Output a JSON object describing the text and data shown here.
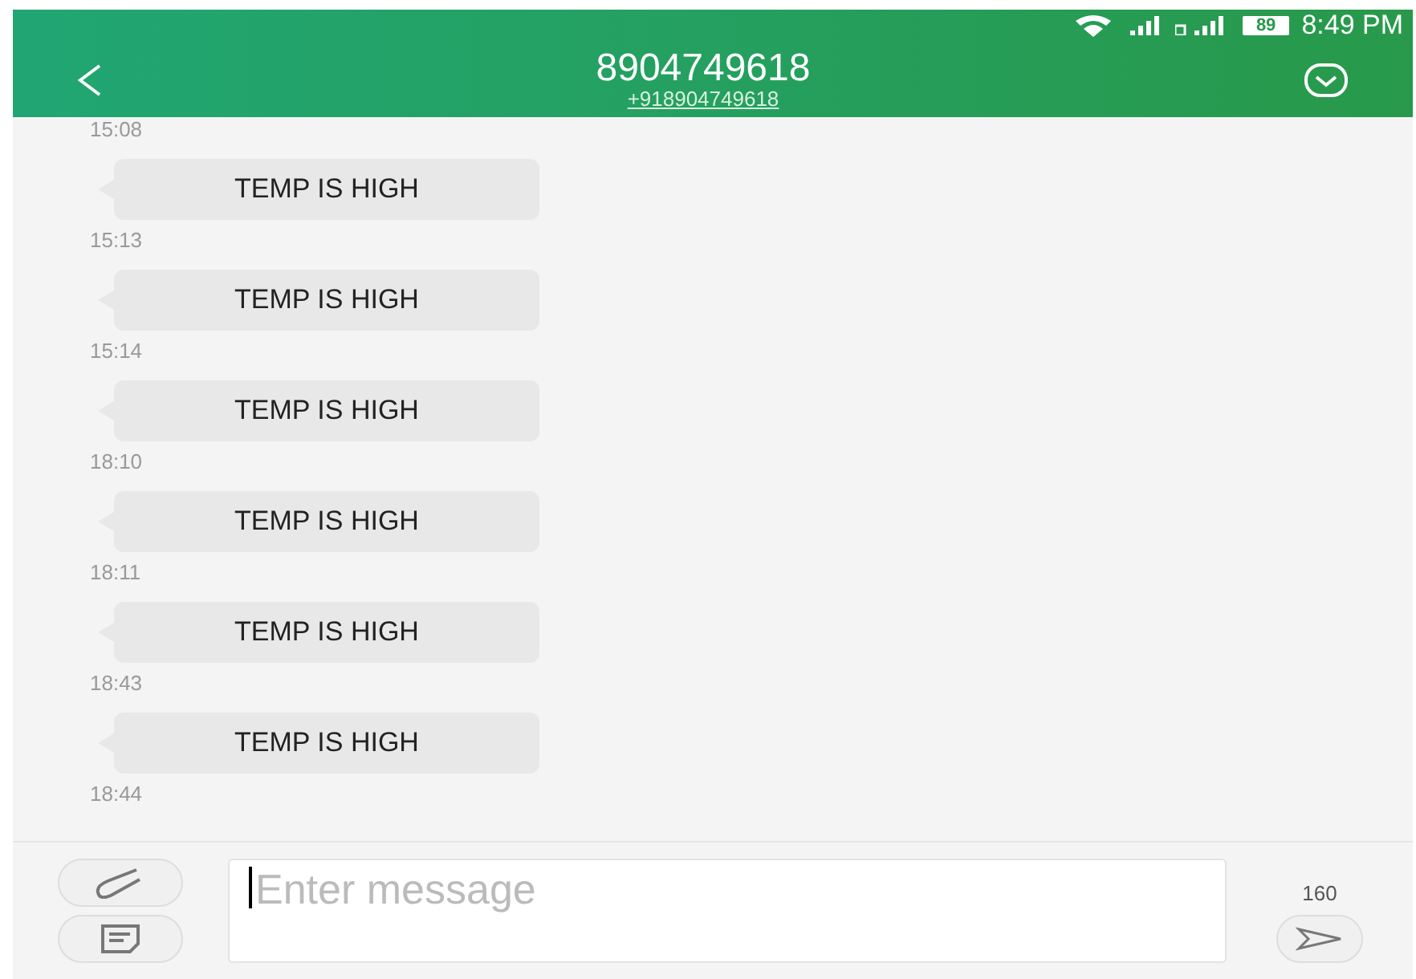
{
  "status_bar": {
    "battery": "89",
    "time": "8:49 PM"
  },
  "header": {
    "title": "8904749618",
    "subtitle": "+918904749618"
  },
  "first_time": "15:08",
  "messages": [
    {
      "text": "TEMP IS HIGH",
      "time": "15:13"
    },
    {
      "text": "TEMP IS HIGH",
      "time": "15:14"
    },
    {
      "text": "TEMP IS HIGH",
      "time": "18:10"
    },
    {
      "text": "TEMP IS HIGH",
      "time": "18:11"
    },
    {
      "text": "TEMP IS HIGH",
      "time": "18:43"
    },
    {
      "text": "TEMP IS HIGH",
      "time": "18:44"
    }
  ],
  "composer": {
    "placeholder": "Enter message",
    "counter": "160"
  }
}
